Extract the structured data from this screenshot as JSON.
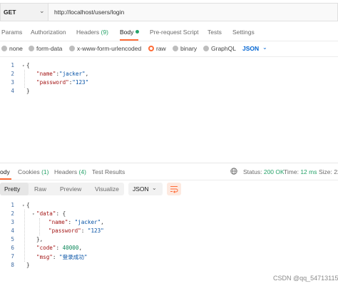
{
  "request": {
    "method": "GET",
    "url": "http://localhost/users/login",
    "tabs": {
      "params": "Params",
      "authorization": "Authorization",
      "headers": "Headers",
      "headers_count": "(9)",
      "body": "Body",
      "pre_request": "Pre-request Script",
      "tests": "Tests",
      "settings": "Settings"
    },
    "body_types": {
      "none": "none",
      "form_data": "form-data",
      "urlencoded": "x-www-form-urlencoded",
      "raw": "raw",
      "binary": "binary",
      "graphql": "GraphQL",
      "selected": "raw"
    },
    "language": "JSON",
    "code": {
      "line_numbers": [
        "1",
        "2",
        "3",
        "4"
      ],
      "lines": [
        {
          "text": "{"
        },
        {
          "key": "\"name\"",
          "sep": ":",
          "value": "\"jacker\"",
          "end": ","
        },
        {
          "key": "\"password\"",
          "sep": ":",
          "value": "\"123\""
        },
        {
          "text": "}"
        }
      ]
    }
  },
  "response": {
    "tabs": {
      "body": "ody",
      "cookies": "Cookies",
      "cookies_count": "(1)",
      "headers": "Headers",
      "headers_count": "(4)",
      "test_results": "Test Results"
    },
    "status_label": "Status:",
    "status_value": "200 OK",
    "time_label": "Time:",
    "time_value": "12 ms",
    "size_label": "Size: 22",
    "views": {
      "pretty": "Pretty",
      "raw": "Raw",
      "preview": "Preview",
      "visualize": "Visualize"
    },
    "format": "JSON",
    "code": {
      "line_numbers": [
        "1",
        "2",
        "3",
        "4",
        "5",
        "6",
        "7",
        "8"
      ],
      "l1": "{",
      "l2_key": "\"data\"",
      "l2_rest": ": {",
      "l3_key": "\"name\"",
      "l3_sep": ": ",
      "l3_val": "\"jacker\"",
      "l3_end": ",",
      "l4_key": "\"password\"",
      "l4_sep": ": ",
      "l4_val": "\"123\"",
      "l5": "},",
      "l6_key": "\"code\"",
      "l6_sep": ": ",
      "l6_val": "40000",
      "l6_end": ",",
      "l7_key": "\"msg\"",
      "l7_sep": ": ",
      "l7_val": "\"登录成功\"",
      "l8": "}"
    }
  },
  "watermark": "CSDN @qq_54713115",
  "colors": {
    "accent": "#ff6c37",
    "success": "#26a269",
    "link": "#0265d2"
  }
}
